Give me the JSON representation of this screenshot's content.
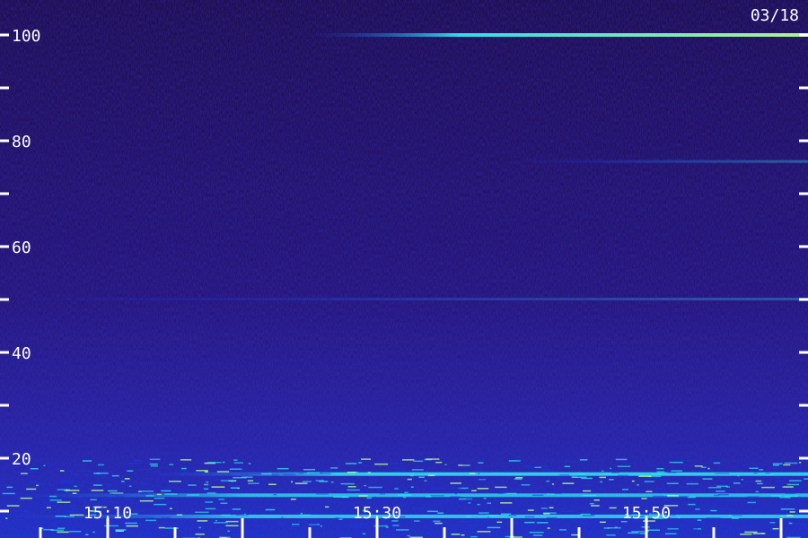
{
  "chart_data": {
    "type": "heatmap",
    "date_label": "03/18",
    "yticks": [
      100,
      80,
      60,
      40,
      20
    ],
    "ylim": [
      0,
      102
    ],
    "xticks": [
      "15:10",
      "15:30",
      "15:50"
    ],
    "xlim": [
      "15:02",
      "16:02"
    ],
    "grid": false,
    "colors": {
      "background": "#1c0a4a",
      "low": "#20107a",
      "mid": "#1a3ad8",
      "high": "#30e8f0",
      "peak": "#b8ff90",
      "axis": "#ffffff"
    },
    "bands": [
      {
        "y": 100,
        "x_start": "15:25",
        "x_end": "16:02",
        "intensity": 0.95
      },
      {
        "y": 76,
        "x_start": "15:40",
        "x_end": "16:02",
        "intensity": 0.35
      },
      {
        "y": 50,
        "x_start": "15:02",
        "x_end": "16:02",
        "intensity": 0.3
      },
      {
        "y": 17,
        "x_start": "15:12",
        "x_end": "16:02",
        "intensity": 0.85
      },
      {
        "y": 13,
        "x_start": "15:02",
        "x_end": "16:02",
        "intensity": 0.75
      },
      {
        "y": 9,
        "x_start": "15:02",
        "x_end": "16:02",
        "intensity": 0.8
      },
      {
        "y": 4,
        "x_start": "15:02",
        "x_end": "16:02",
        "intensity": 0.7
      }
    ]
  }
}
